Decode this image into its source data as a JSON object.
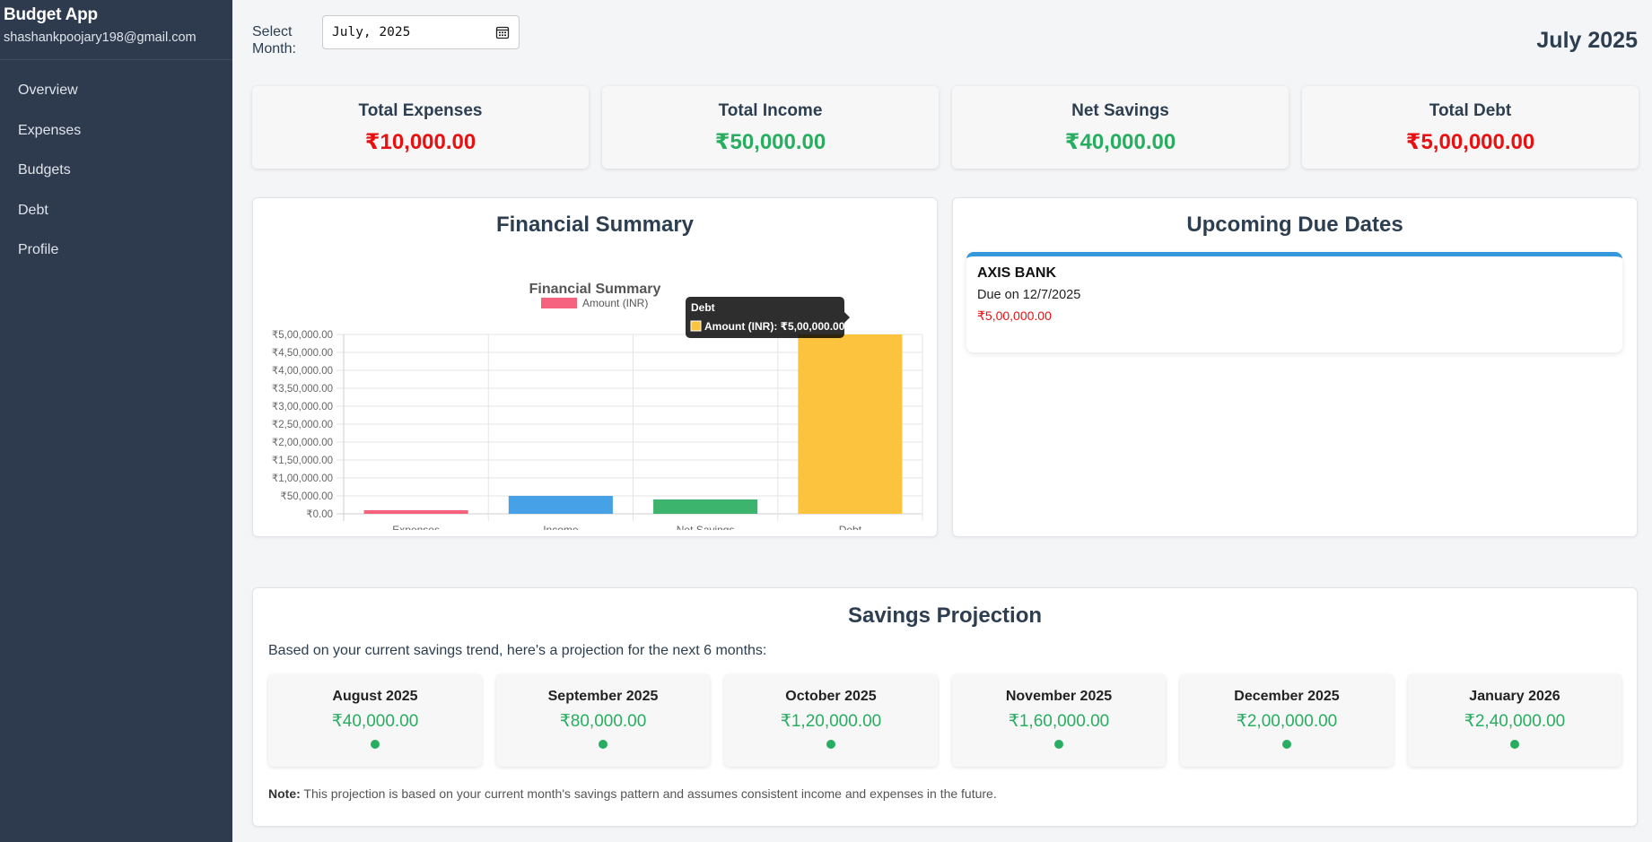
{
  "sidebar": {
    "brand": "Budget App",
    "email": "shashankpoojary198@gmail.com",
    "items": [
      {
        "label": "Overview"
      },
      {
        "label": "Expenses"
      },
      {
        "label": "Budgets"
      },
      {
        "label": "Debt"
      },
      {
        "label": "Profile"
      }
    ]
  },
  "header": {
    "select_label": "Select Month:",
    "month_value": "July, 2025",
    "title": "July 2025"
  },
  "stats": [
    {
      "label": "Total Expenses",
      "value": "₹10,000.00",
      "color": "#e81010"
    },
    {
      "label": "Total Income",
      "value": "₹50,000.00",
      "color": "#27ae60"
    },
    {
      "label": "Net Savings",
      "value": "₹40,000.00",
      "color": "#27ae60"
    },
    {
      "label": "Total Debt",
      "value": "₹5,00,000.00",
      "color": "#e81010"
    }
  ],
  "financial_summary": {
    "heading": "Financial Summary"
  },
  "chart_data": {
    "type": "bar",
    "title": "Financial Summary",
    "legend": "Amount (INR)",
    "categories": [
      "Expenses",
      "Income",
      "Net Savings",
      "Debt"
    ],
    "values": [
      10000,
      50000,
      40000,
      500000
    ],
    "colors": [
      "#f5637f",
      "#47a1e6",
      "#3cb46e",
      "#fcc43e"
    ],
    "ylim": [
      0,
      500000
    ],
    "yticks": [
      "₹0.00",
      "₹50,000.00",
      "₹1,00,000.00",
      "₹1,50,000.00",
      "₹2,00,000.00",
      "₹2,50,000.00",
      "₹3,00,000.00",
      "₹3,50,000.00",
      "₹4,00,000.00",
      "₹4,50,000.00",
      "₹5,00,000.00"
    ],
    "grid": true,
    "tooltip": {
      "title": "Debt",
      "label": "Amount (INR): ₹5,00,000.00"
    }
  },
  "due_dates": {
    "heading": "Upcoming Due Dates",
    "items": [
      {
        "bank": "AXIS BANK",
        "due": "Due on 12/7/2025",
        "amount": "₹5,00,000.00"
      }
    ]
  },
  "projection": {
    "heading": "Savings Projection",
    "intro": "Based on your current savings trend, here's a projection for the next 6 months:",
    "months": [
      {
        "month": "August 2025",
        "value": "₹40,000.00"
      },
      {
        "month": "September 2025",
        "value": "₹80,000.00"
      },
      {
        "month": "October 2025",
        "value": "₹1,20,000.00"
      },
      {
        "month": "November 2025",
        "value": "₹1,60,000.00"
      },
      {
        "month": "December 2025",
        "value": "₹2,00,000.00"
      },
      {
        "month": "January 2026",
        "value": "₹2,40,000.00"
      }
    ],
    "note_label": "Note:",
    "note_text": " This projection is based on your current month's savings pattern and assumes consistent income and expenses in the future."
  }
}
